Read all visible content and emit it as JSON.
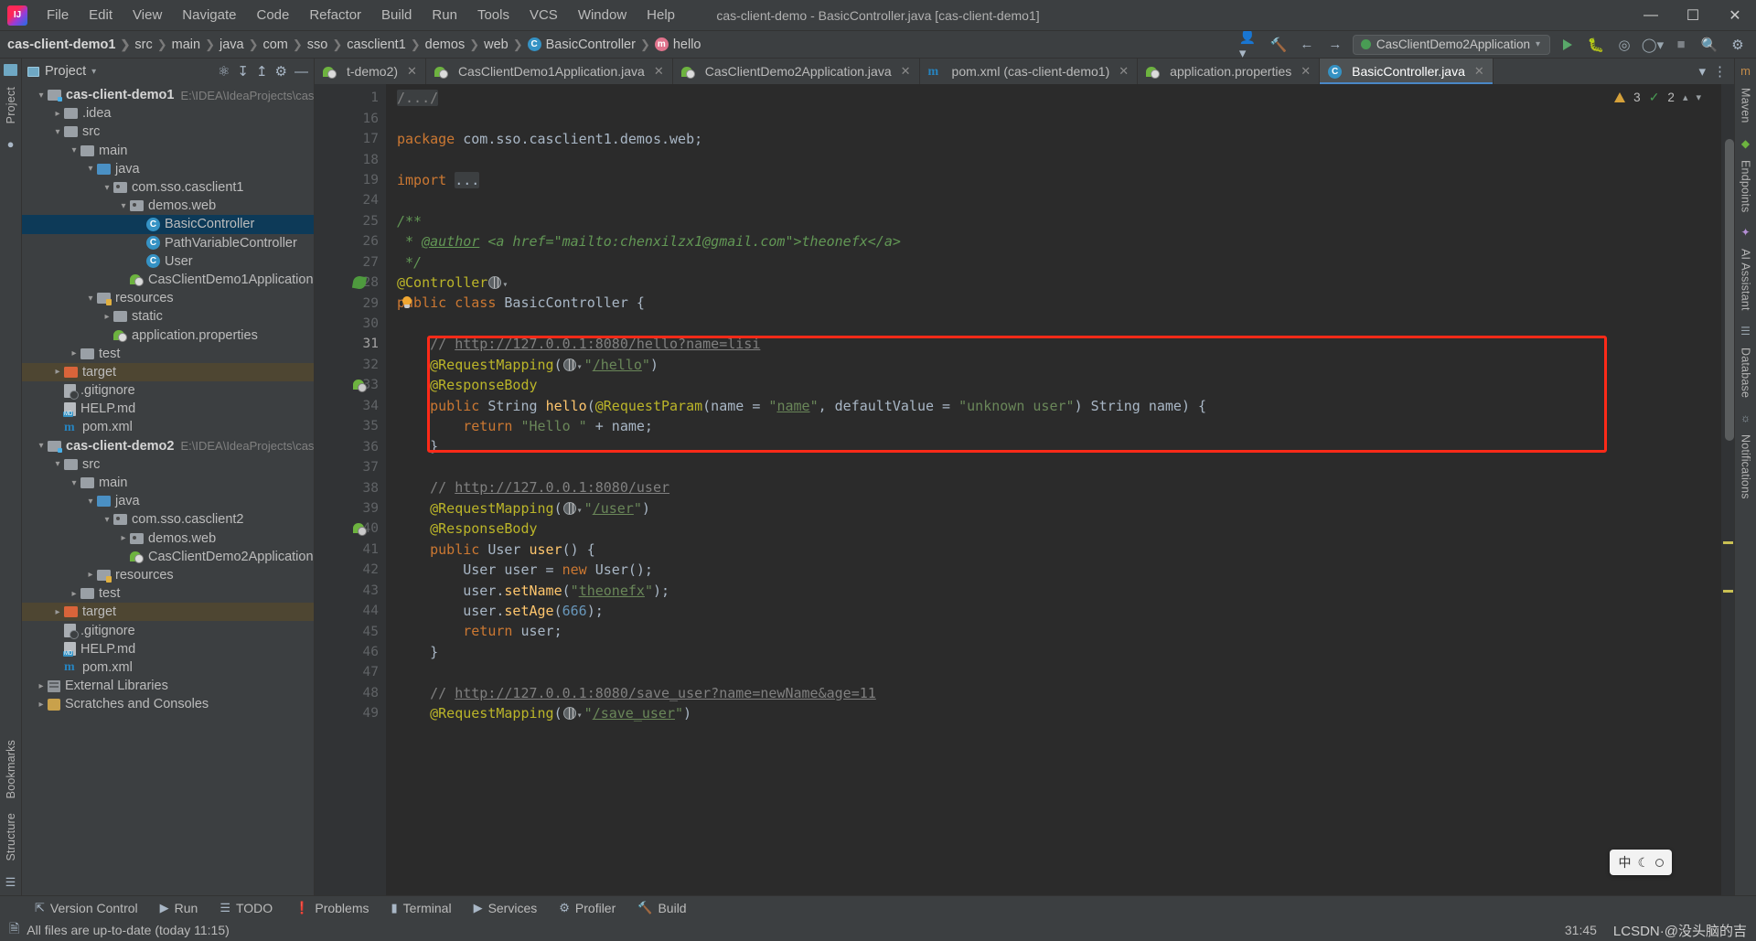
{
  "window": {
    "title": "cas-client-demo - BasicController.java [cas-client-demo1]",
    "logo_icon": "intellij-idea-logo",
    "minimize_icon": "minimize-icon",
    "maximize_icon": "maximize-icon",
    "close_icon": "close-icon"
  },
  "menu": [
    "File",
    "Edit",
    "View",
    "Navigate",
    "Code",
    "Refactor",
    "Build",
    "Run",
    "Tools",
    "VCS",
    "Window",
    "Help"
  ],
  "breadcrumb": [
    "cas-client-demo1",
    "src",
    "main",
    "java",
    "com",
    "sso",
    "casclient1",
    "demos",
    "web",
    "BasicController",
    "hello"
  ],
  "navbar_right": {
    "avatar_icon": "user-settings-icon",
    "build_icon": "hammer-build-icon",
    "back_icon": "arrow-back-icon",
    "forward_icon": "arrow-forward-icon",
    "run_config": "CasClientDemo2Application",
    "run_icon": "run-icon",
    "debug_icon": "debug-icon",
    "coverage_icon": "coverage-icon",
    "profiler_icon": "profiler-icon",
    "stop_icon": "stop-icon",
    "search_icon": "search-icon",
    "settings_icon": "settings-gear-icon"
  },
  "left_strip": [
    "Project",
    "Commit"
  ],
  "left_strip_bottom": [
    "Bookmarks",
    "Structure"
  ],
  "right_strip": [
    "Maven",
    "Endpoints",
    "AI Assistant",
    "Database",
    "Notifications"
  ],
  "project_panel": {
    "title": "Project",
    "dropdown_icon": "chevron-down-icon",
    "locate_icon": "locate-file-icon",
    "expand_icon": "expand-all-icon",
    "collapse_icon": "collapse-all-icon",
    "settings_icon": "gear-icon",
    "hide_icon": "hide-panel-icon",
    "tree": [
      {
        "label": "cas-client-demo1",
        "path": "E:\\IDEA\\IdeaProjects\\cas-cli",
        "depth": 0,
        "twist": "expanded",
        "icon": "module-folder",
        "bold": true
      },
      {
        "label": ".idea",
        "depth": 1,
        "twist": "collapsed",
        "icon": "folder"
      },
      {
        "label": "src",
        "depth": 1,
        "twist": "expanded",
        "icon": "folder"
      },
      {
        "label": "main",
        "depth": 2,
        "twist": "expanded",
        "icon": "folder"
      },
      {
        "label": "java",
        "depth": 3,
        "twist": "expanded",
        "icon": "source-folder"
      },
      {
        "label": "com.sso.casclient1",
        "depth": 4,
        "twist": "expanded",
        "icon": "package"
      },
      {
        "label": "demos.web",
        "depth": 5,
        "twist": "expanded",
        "icon": "package"
      },
      {
        "label": "BasicController",
        "depth": 6,
        "twist": "none",
        "icon": "java-class",
        "selected": true
      },
      {
        "label": "PathVariableController",
        "depth": 6,
        "twist": "none",
        "icon": "java-class"
      },
      {
        "label": "User",
        "depth": 6,
        "twist": "none",
        "icon": "java-class"
      },
      {
        "label": "CasClientDemo1Application",
        "depth": 5,
        "twist": "none",
        "icon": "spring-boot-class"
      },
      {
        "label": "resources",
        "depth": 3,
        "twist": "expanded",
        "icon": "resources-folder"
      },
      {
        "label": "static",
        "depth": 4,
        "twist": "collapsed",
        "icon": "folder"
      },
      {
        "label": "application.properties",
        "depth": 4,
        "twist": "none",
        "icon": "spring-properties"
      },
      {
        "label": "test",
        "depth": 2,
        "twist": "collapsed",
        "icon": "folder"
      },
      {
        "label": "target",
        "depth": 1,
        "twist": "collapsed",
        "icon": "excluded-folder",
        "highlighted": true
      },
      {
        "label": ".gitignore",
        "depth": 1,
        "twist": "none",
        "icon": "gitignore-file"
      },
      {
        "label": "HELP.md",
        "depth": 1,
        "twist": "none",
        "icon": "markdown-file"
      },
      {
        "label": "pom.xml",
        "depth": 1,
        "twist": "none",
        "icon": "maven-file"
      },
      {
        "label": "cas-client-demo2",
        "path": "E:\\IDEA\\IdeaProjects\\cas-cli",
        "depth": 0,
        "twist": "expanded",
        "icon": "module-folder",
        "bold": true
      },
      {
        "label": "src",
        "depth": 1,
        "twist": "expanded",
        "icon": "folder"
      },
      {
        "label": "main",
        "depth": 2,
        "twist": "expanded",
        "icon": "folder"
      },
      {
        "label": "java",
        "depth": 3,
        "twist": "expanded",
        "icon": "source-folder"
      },
      {
        "label": "com.sso.casclient2",
        "depth": 4,
        "twist": "expanded",
        "icon": "package"
      },
      {
        "label": "demos.web",
        "depth": 5,
        "twist": "collapsed",
        "icon": "package"
      },
      {
        "label": "CasClientDemo2Application",
        "depth": 5,
        "twist": "none",
        "icon": "spring-boot-class"
      },
      {
        "label": "resources",
        "depth": 3,
        "twist": "collapsed",
        "icon": "resources-folder"
      },
      {
        "label": "test",
        "depth": 2,
        "twist": "collapsed",
        "icon": "folder"
      },
      {
        "label": "target",
        "depth": 1,
        "twist": "collapsed",
        "icon": "excluded-folder",
        "highlighted": true
      },
      {
        "label": ".gitignore",
        "depth": 1,
        "twist": "none",
        "icon": "gitignore-file"
      },
      {
        "label": "HELP.md",
        "depth": 1,
        "twist": "none",
        "icon": "markdown-file"
      },
      {
        "label": "pom.xml",
        "depth": 1,
        "twist": "none",
        "icon": "maven-file"
      },
      {
        "label": "External Libraries",
        "depth": 0,
        "twist": "collapsed",
        "icon": "libraries"
      },
      {
        "label": "Scratches and Consoles",
        "depth": 0,
        "twist": "collapsed",
        "icon": "scratches"
      }
    ]
  },
  "tabs": [
    {
      "label": "t-demo2)",
      "icon": "spring-boot-class",
      "active": false,
      "truncated": true
    },
    {
      "label": "CasClientDemo1Application.java",
      "icon": "spring-boot-class",
      "active": false
    },
    {
      "label": "CasClientDemo2Application.java",
      "icon": "spring-boot-class",
      "active": false
    },
    {
      "label": "pom.xml (cas-client-demo1)",
      "icon": "maven-file",
      "active": false
    },
    {
      "label": "application.properties",
      "icon": "spring-properties",
      "active": false
    },
    {
      "label": "BasicController.java",
      "icon": "java-class",
      "active": true
    }
  ],
  "inspection_badge": {
    "warning_count": "3",
    "check_count": "2",
    "warning_icon": "warning-triangle-icon",
    "check_icon": "checkmark-icon",
    "chevron_up_icon": "chevron-up-icon",
    "chevron_down_icon": "chevron-down-icon"
  },
  "editor": {
    "filename": "BasicController.java",
    "lines": [
      {
        "n": "1",
        "fold": "plus",
        "html": "<span class=\"folded cmt\">/.../</span>"
      },
      {
        "n": "16",
        "fold": "",
        "html": ""
      },
      {
        "n": "17",
        "fold": "",
        "html": "<span class=\"kw\">package</span> com.sso.casclient1.demos.web;"
      },
      {
        "n": "18",
        "fold": "",
        "html": ""
      },
      {
        "n": "19",
        "fold": "plus",
        "html": "<span class=\"kw\">import</span> <span class=\"folded\">...</span>"
      },
      {
        "n": "24",
        "fold": "",
        "html": ""
      },
      {
        "n": "25",
        "fold": "top",
        "html": "<span class=\"jdoc\">/**</span>"
      },
      {
        "n": "26",
        "fold": "",
        "html": "<span class=\"jdoc\"> * </span><span class=\"jdoc-tag\">@author</span><span class=\"jdoc\"> &lt;a href=\"mailto:chenxilzx1@gmail.com\"&gt;theonefx&lt;/a&gt;</span>"
      },
      {
        "n": "27",
        "fold": "bot",
        "html": "<span class=\"jdoc\"> */</span>"
      },
      {
        "n": "28",
        "fold": "",
        "html": "<span class=\"ann\">@Controller</span><span class=\"globe\"></span><span class=\"chev\">&#9662;</span>"
      },
      {
        "n": "29",
        "fold": "",
        "html": "<span class=\"kw\">public class</span> <span class=\"typ\">BasicController</span> {"
      },
      {
        "n": "30",
        "fold": "",
        "html": ""
      },
      {
        "n": "31",
        "fold": "",
        "html": "    <span class=\"cmt\">// </span><span class=\"cmt-link\">http://127.0.0.1:8080/hello?name=lisi</span>"
      },
      {
        "n": "32",
        "fold": "top",
        "html": "    <span class=\"ann\">@RequestMapping</span>(<span class=\"globe\"></span><span class=\"chev\">&#9662;</span><span class=\"str\">\"</span><span class=\"strlink\">/hello</span><span class=\"str\">\"</span>)"
      },
      {
        "n": "33",
        "fold": "mid",
        "html": "    <span class=\"ann\">@ResponseBody</span>"
      },
      {
        "n": "34",
        "fold": "mid",
        "html": "    <span class=\"kw\">public</span> <span class=\"typ\">String</span> <span class=\"mth\">hello</span>(<span class=\"ann\">@RequestParam</span>(name = <span class=\"str\">\"</span><span class=\"strlink\">name</span><span class=\"str\">\"</span>, defaultValue = <span class=\"str\">\"unknown user\"</span>) <span class=\"typ\">String</span> name) {"
      },
      {
        "n": "35",
        "fold": "",
        "html": "        <span class=\"kw\">return</span> <span class=\"str\">\"Hello \"</span> + name;"
      },
      {
        "n": "36",
        "fold": "bot",
        "html": "    }"
      },
      {
        "n": "37",
        "fold": "",
        "html": ""
      },
      {
        "n": "38",
        "fold": "",
        "html": "    <span class=\"cmt\">// </span><span class=\"cmt-link\">http://127.0.0.1:8080/user</span>"
      },
      {
        "n": "39",
        "fold": "top",
        "html": "    <span class=\"ann\">@RequestMapping</span>(<span class=\"globe\"></span><span class=\"chev\">&#9662;</span><span class=\"str\">\"</span><span class=\"strlink\">/user</span><span class=\"str\">\"</span>)"
      },
      {
        "n": "40",
        "fold": "mid",
        "html": "    <span class=\"ann\">@ResponseBody</span>"
      },
      {
        "n": "41",
        "fold": "mid",
        "html": "    <span class=\"kw\">public</span> <span class=\"typ\">User</span> <span class=\"mth\">user</span>() {"
      },
      {
        "n": "42",
        "fold": "",
        "html": "        <span class=\"typ\">User</span> user = <span class=\"kw\">new</span> <span class=\"typ\">User</span>();"
      },
      {
        "n": "43",
        "fold": "",
        "html": "        user.<span class=\"mth\">setName</span>(<span class=\"str\">\"</span><span class=\"strlink\">theonefx</span><span class=\"str\">\"</span>);"
      },
      {
        "n": "44",
        "fold": "",
        "html": "        user.<span class=\"mth\">setAge</span>(<span class=\"num\">666</span>);"
      },
      {
        "n": "45",
        "fold": "",
        "html": "        <span class=\"kw\">return</span> user;"
      },
      {
        "n": "46",
        "fold": "bot",
        "html": "    }"
      },
      {
        "n": "47",
        "fold": "",
        "html": ""
      },
      {
        "n": "48",
        "fold": "",
        "html": "    <span class=\"cmt\">// </span><span class=\"cmt-link\">http://127.0.0.1:8080/save_user?name=newName&amp;age=11</span>"
      },
      {
        "n": "49",
        "fold": "top",
        "html": "    <span class=\"ann\">@RequestMapping</span>(<span class=\"globe\"></span><span class=\"chev\">&#9662;</span><span class=\"str\">\"</span><span class=\"strlink\">/save_user</span><span class=\"str\">\"</span>)"
      }
    ],
    "gutter_markers": [
      {
        "line_index": 9,
        "type": "leaf-icon"
      },
      {
        "line_index": 14,
        "type": "spring-bean-icon"
      },
      {
        "line_index": 21,
        "type": "spring-bean-icon"
      }
    ],
    "bulb": {
      "line_index": 10,
      "icon": "intention-bulb-icon"
    },
    "highlight_box": {
      "label": "red-annotation-box",
      "color": "#ff2a18"
    }
  },
  "bottom_bar": [
    {
      "label": "Version Control",
      "icon": "branch-icon"
    },
    {
      "label": "Run",
      "icon": "run-icon"
    },
    {
      "label": "TODO",
      "icon": "todo-list-icon"
    },
    {
      "label": "Problems",
      "icon": "problems-icon"
    },
    {
      "label": "Terminal",
      "icon": "terminal-icon"
    },
    {
      "label": "Services",
      "icon": "services-icon"
    },
    {
      "label": "Profiler",
      "icon": "profiler-icon"
    },
    {
      "label": "Build",
      "icon": "build-hammer-icon"
    }
  ],
  "status_bar": {
    "message_icon": "event-log-icon",
    "message": "All files are up-to-date (today 11:15)",
    "caret_position": "31:45",
    "watermark": "LCSDN·@没头脑的吉"
  },
  "ime_pill": {
    "mode": "中",
    "moon_icon": "moon-icon",
    "circle_icon": "circle-icon"
  }
}
